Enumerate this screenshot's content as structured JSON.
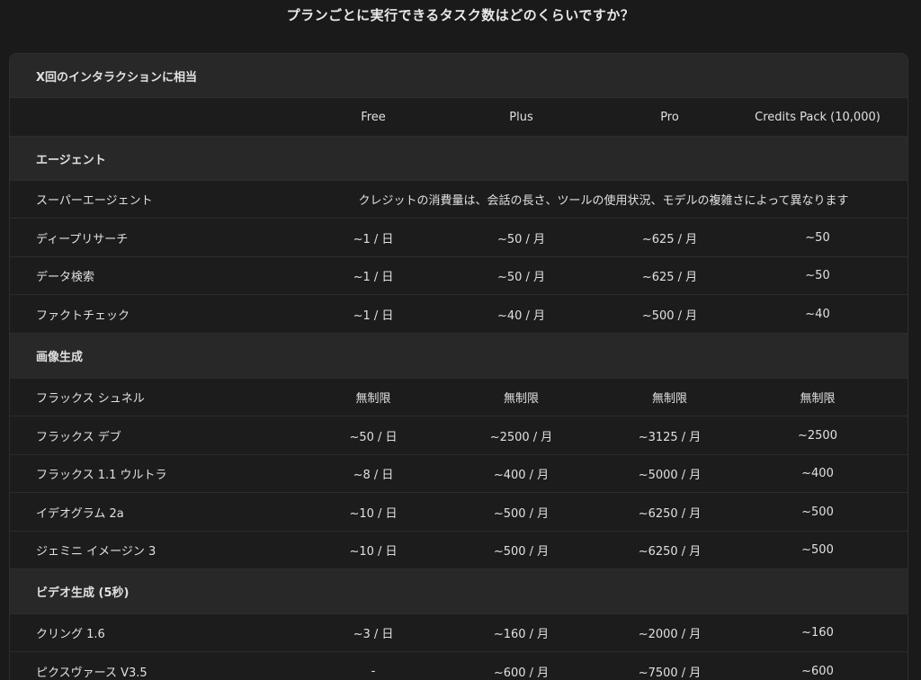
{
  "title": "プランごとに実行できるタスク数はどのくらいですか？",
  "table": {
    "caption": "X回のインタラクションに相当",
    "columns": [
      "",
      "Free",
      "Plus",
      "Pro",
      "Credits Pack (10,000)"
    ],
    "groups": [
      {
        "name": "エージェント",
        "rows": [
          {
            "label": "スーパーエージェント",
            "span": "クレジットの消費量は、会話の長さ、ツールの使用状況、モデルの複雑さによって異なります"
          },
          {
            "label": "ディープリサーチ",
            "values": [
              "~1 / 日",
              "~50 / 月",
              "~625 / 月",
              "~50"
            ]
          },
          {
            "label": "データ検索",
            "values": [
              "~1 / 日",
              "~50 / 月",
              "~625 / 月",
              "~50"
            ]
          },
          {
            "label": "ファクトチェック",
            "values": [
              "~1 / 日",
              "~40 / 月",
              "~500 / 月",
              "~40"
            ]
          }
        ]
      },
      {
        "name": "画像生成",
        "rows": [
          {
            "label": "フラックス シュネル",
            "values": [
              "無制限",
              "無制限",
              "無制限",
              "無制限"
            ]
          },
          {
            "label": "フラックス デブ",
            "values": [
              "~50 / 日",
              "~2500 / 月",
              "~3125 / 月",
              "~2500"
            ]
          },
          {
            "label": "フラックス 1.1 ウルトラ",
            "values": [
              "~8 / 日",
              "~400 / 月",
              "~5000 / 月",
              "~400"
            ]
          },
          {
            "label": "イデオグラム 2a",
            "values": [
              "~10 / 日",
              "~500 / 月",
              "~6250 / 月",
              "~500"
            ]
          },
          {
            "label": "ジェミニ イメージン 3",
            "values": [
              "~10 / 日",
              "~500 / 月",
              "~6250 / 月",
              "~500"
            ]
          }
        ]
      },
      {
        "name": "ビデオ生成 (5秒)",
        "rows": [
          {
            "label": "クリング 1.6",
            "values": [
              "~3 / 日",
              "~160 / 月",
              "~2000 / 月",
              "~160"
            ]
          },
          {
            "label": "ピクスヴァース V3.5",
            "values": [
              "-",
              "~600 / 月",
              "~7500 / 月",
              "~600"
            ]
          }
        ]
      }
    ]
  }
}
